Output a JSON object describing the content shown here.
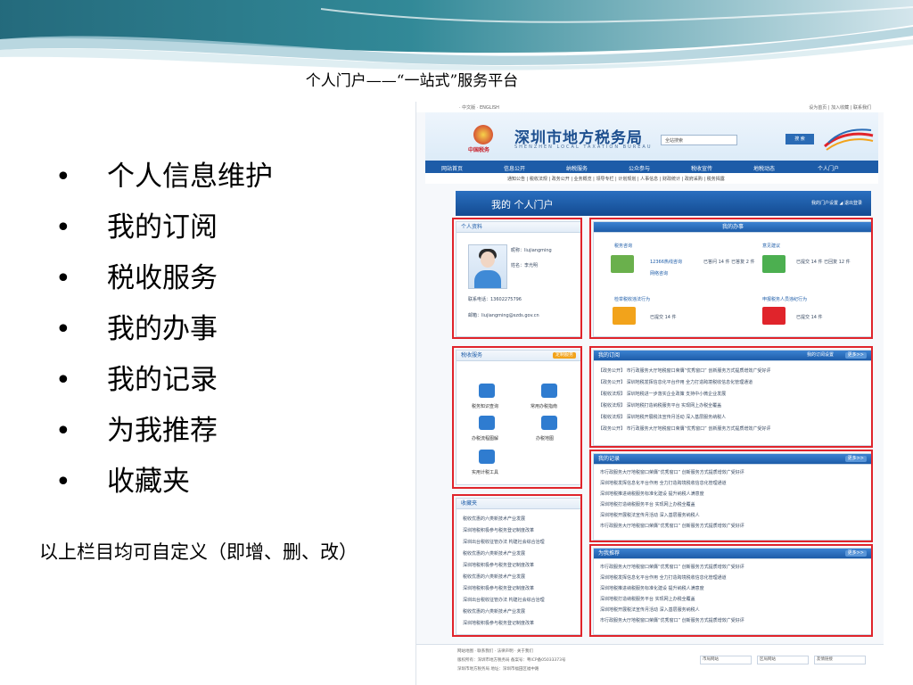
{
  "slide": {
    "title": "个人门户——“一站式”服务平台",
    "bullets": [
      "个人信息维护",
      "我的订阅",
      "税收服务",
      "我的办事",
      "我的记录",
      "为我推荐",
      "收藏夹"
    ],
    "bullet_symbol": "•",
    "note": "以上栏目均可自定义（即增、删、改）"
  },
  "site": {
    "topbar_left": "· 中文版 · ENGLISH",
    "topbar_right": "设为首页 | 加入收藏 | 联系我们",
    "logo_sub": "中国税务",
    "bureau_name": "深圳市地方税务局",
    "bureau_en": "SHENZHEN LOCAL TAXATION BUREAU",
    "search_placeholder": "全站搜索",
    "search_button": "搜 索",
    "nav": [
      "网站首页",
      "信息公开",
      "纳税服务",
      "公众参与",
      "税收宣传",
      "地税动态",
      "个人门户"
    ],
    "subnav": "通知公告 | 税收法规 | 政务公开 | 业务概览 | 领导专栏 | 计划规划 | 人事信息 | 财政统计 | 政府采购 | 税务揭露",
    "portal_title": "我的 个人门户",
    "portal_actions": "我的门户设置  ◢ 退出登录",
    "profile": {
      "header": "个人资料",
      "nickname": "昵称：liujiangming",
      "name": "姓名：李光明",
      "phone": "联系电话：13602275796",
      "email": "邮箱：liujiangming@szds.gov.cn"
    },
    "affairs": {
      "header": "我的办事",
      "items": [
        {
          "title": "税务咨询",
          "links": [
            "12366热线咨询",
            "网络咨询"
          ],
          "stats": "已答问 14 件\n已答复 2 件"
        },
        {
          "title": "意见建议",
          "stats": "已提交 14 件\n已回复 12 件"
        },
        {
          "title": "检举税收违法行为",
          "stats": "已提交 14 件"
        },
        {
          "title": "申报税务人员违纪行为",
          "stats": "已提交 14 件"
        }
      ]
    },
    "tax_service": {
      "header": "税收服务",
      "customize": "定制服务",
      "items": [
        "税务知识查询",
        "常用办税指南",
        "办税流程图解",
        "办税地图",
        "实用计税工具"
      ]
    },
    "subscriptions": {
      "header": "我的订阅",
      "manage": "我的订阅设置",
      "more": "更多>>",
      "items": [
        "【政务公开】 市行政服务大厅地税窗口荣膺“优秀窗口” 创新服务方式提质增效广受好评",
        "【政务公开】 深圳地税发挥信息化平台作用 全力打造跨境税收信息化管理通道",
        "【税收法规】 深圳地税进一步落实企业政策 支持中小微企业发展",
        "【税收法规】 深圳地税打造纳税服务平台 实现网上办税全覆盖",
        "【税收法规】 深圳地税开展税法宣传月活动 深入基层服务纳税人",
        "【政务公开】 市行政服务大厅地税窗口荣膺“优秀窗口” 创新服务方式提质增效广受好评"
      ]
    },
    "records": {
      "header": "我的记录",
      "more": "更多>>",
      "items": [
        "市行政服务大厅地税窗口荣膺“优秀窗口” 创新服务方式提质增效广受好评",
        "深圳地税发挥信息化平台作用 全力打造跨境税收信息化管理通道",
        "深圳地税推进纳税服务标准化建设 提升纳税人满意度",
        "深圳地税打造纳税服务平台 实现网上办税全覆盖",
        "深圳地税开展税法宣传月活动 深入基层服务纳税人",
        "市行政服务大厅地税窗口荣膺“优秀窗口” 创新服务方式提质增效广受好评"
      ]
    },
    "recommend": {
      "header": "为我推荐",
      "more": "更多>>",
      "items": [
        "市行政服务大厅地税窗口荣膺“优秀窗口” 创新服务方式提质增效广受好评",
        "深圳地税发挥信息化平台作用 全力打造跨境税收信息化管理通道",
        "深圳地税推进纳税服务标准化建设 提升纳税人满意度",
        "深圳地税打造纳税服务平台 实现网上办税全覆盖",
        "深圳地税开展税法宣传月活动 深入基层服务纳税人",
        "市行政服务大厅地税窗口荣膺“优秀窗口” 创新服务方式提质增效广受好评"
      ]
    },
    "favorites": {
      "header": "收藏夹",
      "items": [
        "税收优惠的六类新技术产业发展",
        "深圳地税积极参与税务登记制度改革",
        "深圳出台税收征管办法 构建社会综合治理",
        "税收优惠的六类新技术产业发展",
        "深圳地税积极参与税务登记制度改革",
        "税收优惠的六类新技术产业发展",
        "深圳地税积极参与税务登记制度改革",
        "深圳出台税收征管办法 构建社会综合治理",
        "税收优惠的六类新技术产业发展",
        "深圳地税积极参与税务登记制度改革"
      ]
    },
    "footer": {
      "links": "网站地图 · 联系我们 · 法律声明 · 关于我们",
      "line1": "版权所有：深圳市地方税务局   备案号：粤ICP备05033373号",
      "line2": "深圳市地方税务局   地址：深圳市福田区福中路",
      "selects": [
        "市局网站",
        "区局网站",
        "友情链接"
      ]
    },
    "colors": {
      "nav": "#1d5ca8",
      "highlight": "#e0242b"
    }
  }
}
